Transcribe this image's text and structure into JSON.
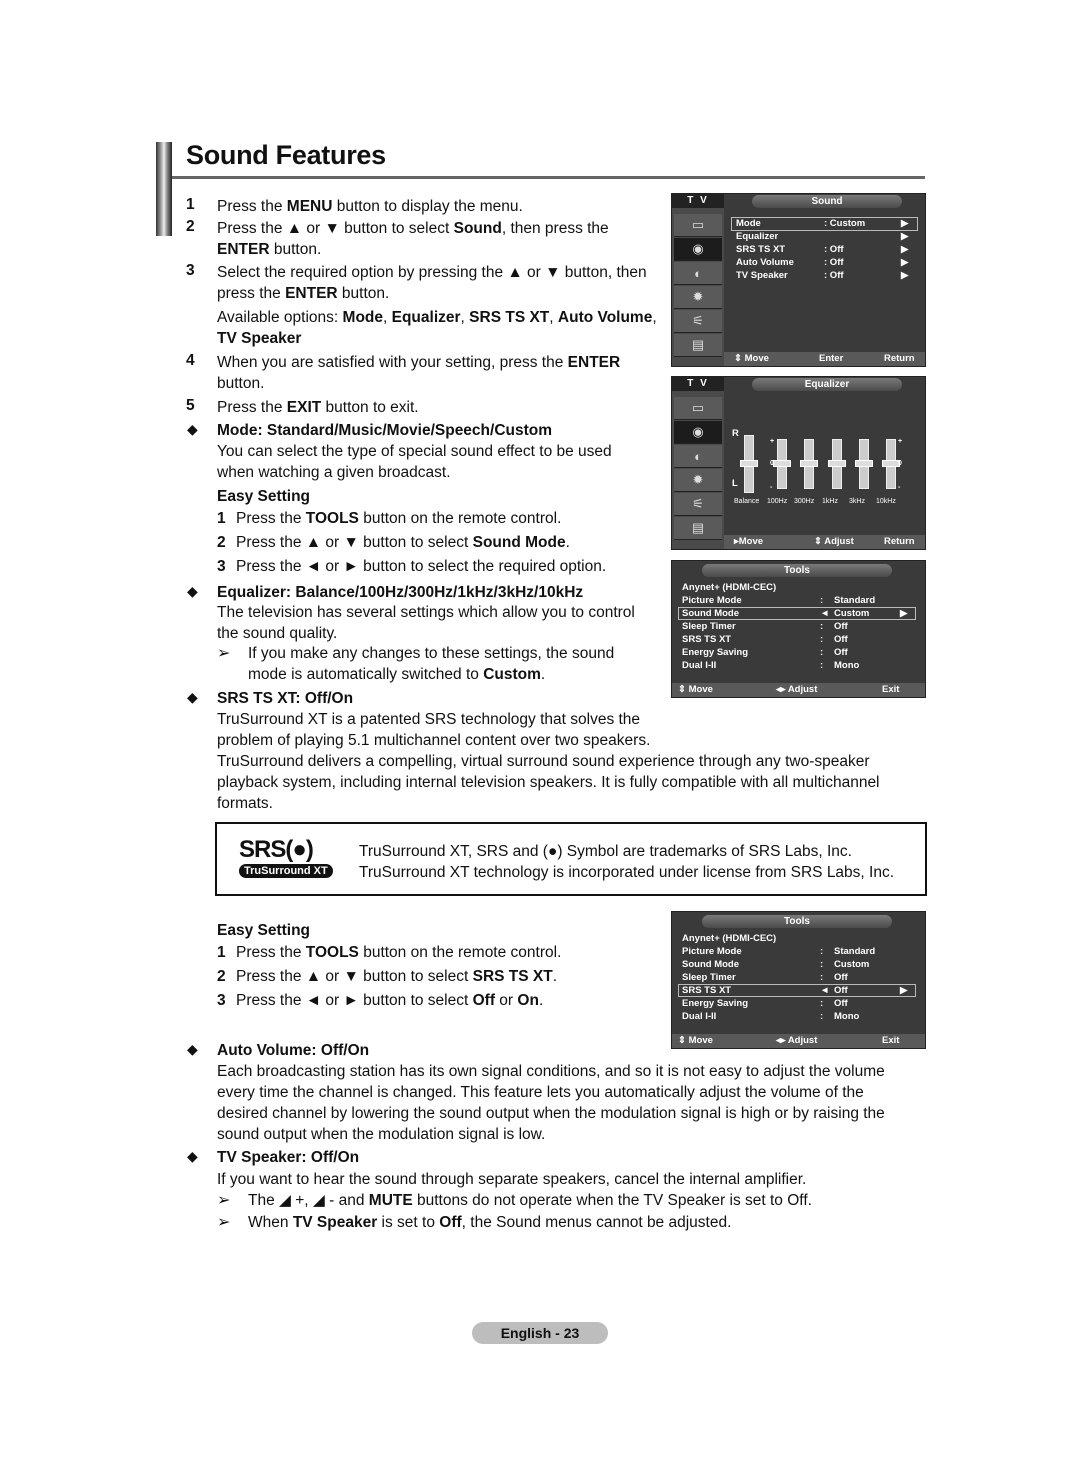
{
  "page": {
    "title": "Sound Features",
    "footer": "English - 23"
  },
  "steps": [
    {
      "n": "1",
      "html": "Press the <b>MENU</b> button to display the menu."
    },
    {
      "n": "2",
      "html": "Press the ▲ or ▼ button to select <b>Sound</b>, then press the <b>ENTER</b> button."
    },
    {
      "n": "3",
      "html": "Select the required option by pressing the ▲ or ▼ button, then press the <b>ENTER</b> button."
    },
    {
      "n": "",
      "html": "Available options: <b>Mode</b>, <b>Equalizer</b>, <b>SRS TS XT</b>, <b>Auto Volume</b>, <b>TV Speaker</b>"
    },
    {
      "n": "4",
      "html": "When you are satisfied with your setting, press the <b>ENTER</b> button."
    },
    {
      "n": "5",
      "html": "Press the <b>EXIT</b> button to exit."
    }
  ],
  "mode": {
    "heading": "Mode: Standard/Music/Movie/Speech/Custom",
    "desc": "You can select the type of special sound effect to be used when watching a given broadcast.",
    "easy_title": "Easy Setting",
    "easy_steps": [
      {
        "n": "1",
        "html": "Press the <b>TOOLS</b> button on the remote control."
      },
      {
        "n": "2",
        "html": "Press the ▲ or ▼ button to select <b>Sound Mode</b>."
      },
      {
        "n": "3",
        "html": "Press the ◄ or ► button to select the required option."
      }
    ]
  },
  "equalizer": {
    "heading": "Equalizer: Balance/100Hz/300Hz/1kHz/3kHz/10kHz",
    "desc": "The television has several settings which allow you to control the sound quality.",
    "note": "If you make any changes to these settings, the sound mode is automatically switched to <b>Custom</b>."
  },
  "srs": {
    "heading": "SRS TS XT: Off/On",
    "desc1": "TruSurround XT is a patented SRS technology that solves the problem of playing 5.1 multichannel content over two speakers.",
    "desc2": "TruSurround delivers a compelling, virtual surround sound experience through any two-speaker playback system, including internal television speakers. It is fully compatible with all multichannel formats.",
    "logo_top": "SRS(●)",
    "logo_bottom": "TruSurround XT",
    "trademark1": "TruSurround XT, SRS and (●) Symbol are trademarks of SRS Labs, Inc.",
    "trademark2": "TruSurround XT technology is incorporated under license from SRS Labs, Inc.",
    "easy_title": "Easy Setting",
    "easy_steps": [
      {
        "n": "1",
        "html": "Press the <b>TOOLS</b> button on the remote control."
      },
      {
        "n": "2",
        "html": "Press the ▲ or ▼ button to select <b>SRS TS XT</b>."
      },
      {
        "n": "3",
        "html": "Press the ◄ or ► button to select <b>Off</b> or <b>On</b>."
      }
    ]
  },
  "auto_volume": {
    "heading": "Auto Volume: Off/On",
    "desc": "Each broadcasting station has its own signal conditions, and so it is not easy to adjust the volume every time the channel is changed. This feature lets you automatically adjust the volume of the desired channel by lowering the sound output when the modulation signal is high or by raising the sound output when the modulation signal is low."
  },
  "tv_speaker": {
    "heading": "TV Speaker: Off/On",
    "desc": "If you want to hear the sound through separate speakers, cancel the internal amplifier.",
    "note1": "The ◢ +, ◢ - and <b>MUTE</b> buttons do not operate when the TV Speaker is set to Off.",
    "note2": "When <b>TV Speaker</b> is set to <b>Off</b>, the Sound menus cannot be adjusted."
  },
  "osd_sound": {
    "tv": "T V",
    "header": "Sound",
    "rows": [
      {
        "label": "Mode",
        "value": ": Custom",
        "arrow": "▶"
      },
      {
        "label": "Equalizer",
        "value": "",
        "arrow": "▶"
      },
      {
        "label": "SRS TS XT",
        "value": ": Off",
        "arrow": "▶"
      },
      {
        "label": "Auto Volume",
        "value": ": Off",
        "arrow": "▶"
      },
      {
        "label": "TV Speaker",
        "value": ": Off",
        "arrow": "▶"
      }
    ],
    "footer": {
      "move": "⇕ Move",
      "enter": "Enter",
      "return": "Return"
    }
  },
  "osd_eq": {
    "tv": "T V",
    "header": "Equalizer",
    "balance_top": "R",
    "balance_bottom": "L",
    "plus": "+",
    "zero": "0",
    "minus": "-",
    "bands": [
      "Balance",
      "100Hz",
      "300Hz",
      "1kHz",
      "3kHz",
      "10kHz"
    ],
    "levels": [
      0,
      0,
      0,
      0,
      0,
      0
    ],
    "footer": {
      "move": "▸Move",
      "adjust": "⇕ Adjust",
      "return": "Return"
    }
  },
  "osd_tools1": {
    "header": "Tools",
    "rows": [
      {
        "label": "Anynet+ (HDMI-CEC)",
        "sep": "",
        "value": ""
      },
      {
        "label": "Picture Mode",
        "sep": ":",
        "value": "Standard"
      },
      {
        "label": "Sound Mode",
        "sep": "◄",
        "value": "Custom",
        "arrow": "▶",
        "selected": true
      },
      {
        "label": "Sleep Timer",
        "sep": ":",
        "value": "Off"
      },
      {
        "label": "SRS TS XT",
        "sep": ":",
        "value": "Off"
      },
      {
        "label": "Energy Saving",
        "sep": ":",
        "value": "Off"
      },
      {
        "label": "Dual I-II",
        "sep": ":",
        "value": "Mono"
      }
    ],
    "footer": {
      "move": "⇕ Move",
      "adjust": "◂▸ Adjust",
      "exit": "Exit"
    }
  },
  "osd_tools2": {
    "header": "Tools",
    "rows": [
      {
        "label": "Anynet+ (HDMI-CEC)",
        "sep": "",
        "value": ""
      },
      {
        "label": "Picture Mode",
        "sep": ":",
        "value": "Standard"
      },
      {
        "label": "Sound Mode",
        "sep": ":",
        "value": "Custom"
      },
      {
        "label": "Sleep Timer",
        "sep": ":",
        "value": "Off"
      },
      {
        "label": "SRS TS XT",
        "sep": "◄",
        "value": "Off",
        "arrow": "▶",
        "selected": true
      },
      {
        "label": "Energy Saving",
        "sep": ":",
        "value": "Off"
      },
      {
        "label": "Dual I-II",
        "sep": ":",
        "value": "Mono"
      }
    ],
    "footer": {
      "move": "⇕ Move",
      "adjust": "◂▸ Adjust",
      "exit": "Exit"
    }
  }
}
